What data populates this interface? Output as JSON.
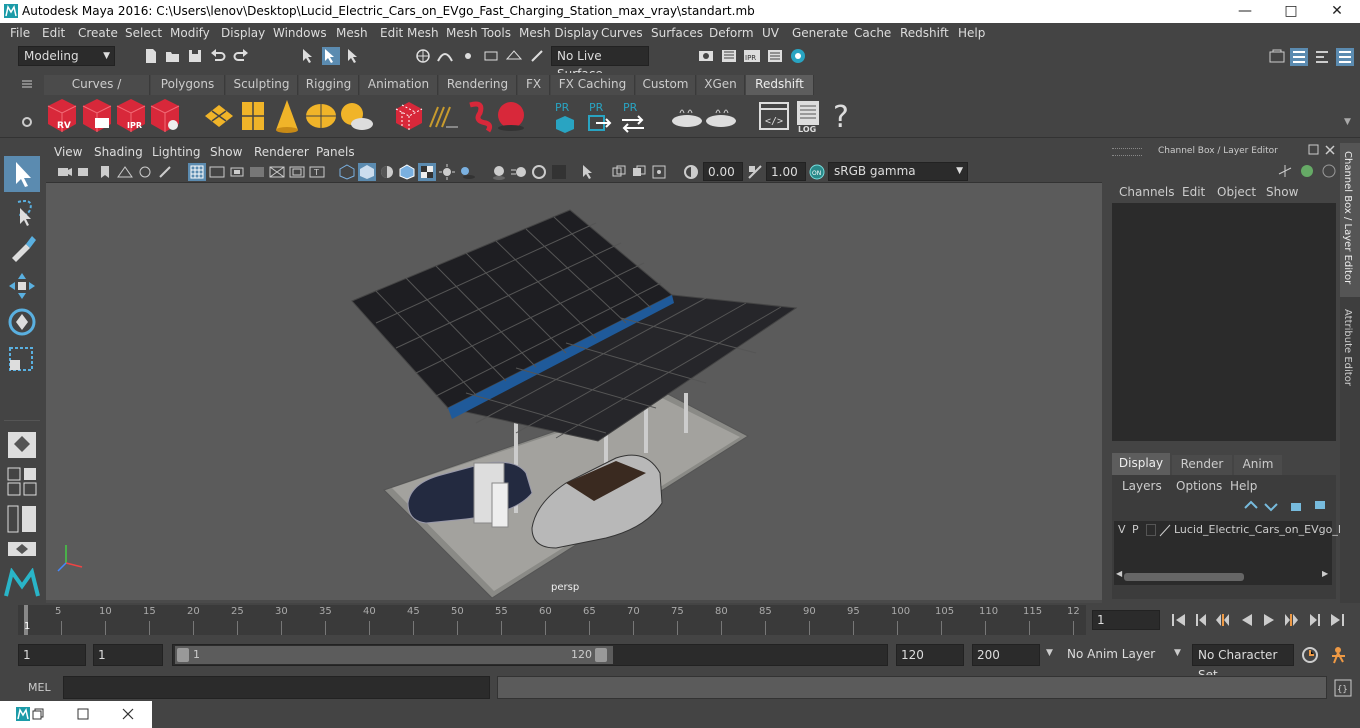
{
  "window": {
    "title": "Autodesk Maya 2016: C:\\Users\\lenov\\Desktop\\Lucid_Electric_Cars_on_EVgo_Fast_Charging_Station_max_vray\\standart.mb"
  },
  "menu": [
    "File",
    "Edit",
    "Create",
    "Select",
    "Modify",
    "Display",
    "Windows",
    "Mesh",
    "Edit Mesh",
    "Mesh Tools",
    "Mesh Display",
    "Curves",
    "Surfaces",
    "Deform",
    "UV",
    "Generate",
    "Cache",
    "Redshift",
    "Help"
  ],
  "status": {
    "mode": "Modeling",
    "live_surface": "No Live Surface"
  },
  "shelf_tabs": [
    "Curves / Surfaces",
    "Polygons",
    "Sculpting",
    "Rigging",
    "Animation",
    "Rendering",
    "FX",
    "FX Caching",
    "Custom",
    "XGen",
    "Redshift"
  ],
  "shelf_active": "Redshift",
  "shelf_icons": {
    "rv": "RV",
    "ipr": "IPR",
    "pr": "PR",
    "log": "LOG",
    "help": "?"
  },
  "viewport": {
    "menu": [
      "View",
      "Shading",
      "Lighting",
      "Show",
      "Renderer",
      "Panels"
    ],
    "exposure": "0.00",
    "gamma": "1.00",
    "colorspace": "sRGB gamma",
    "camera": "persp"
  },
  "channel_box": {
    "title": "Channel Box / Layer Editor",
    "menu": [
      "Channels",
      "Edit",
      "Object",
      "Show"
    ],
    "layer_tabs": [
      "Display",
      "Render",
      "Anim"
    ],
    "layer_tab_active": "Display",
    "layer_menu": [
      "Layers",
      "Options",
      "Help"
    ],
    "layer": {
      "v": "V",
      "p": "P",
      "name": "Lucid_Electric_Cars_on_EVgo_F"
    }
  },
  "side_tabs": [
    "Channel Box / Layer Editor",
    "Attribute Editor"
  ],
  "timeline": {
    "ticks": [
      "5",
      "10",
      "15",
      "20",
      "25",
      "30",
      "35",
      "40",
      "45",
      "50",
      "55",
      "60",
      "65",
      "70",
      "75",
      "80",
      "85",
      "90",
      "95",
      "100",
      "105",
      "110",
      "115",
      "12"
    ],
    "current_marker": "1",
    "current_frame": "1"
  },
  "range": {
    "start": "1",
    "playback_start": "1",
    "slider_start": "1",
    "slider_end": "120",
    "playback_end": "120",
    "end": "200",
    "anim_layer": "No Anim Layer",
    "character_set": "No Character Set"
  },
  "cmd": {
    "label": "MEL"
  }
}
